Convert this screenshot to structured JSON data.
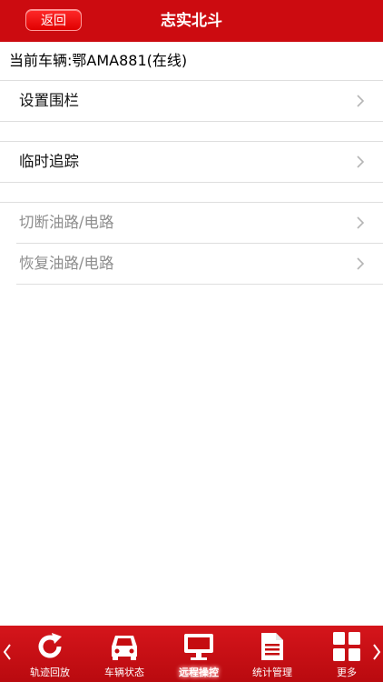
{
  "header": {
    "back_label": "返回",
    "title": "志实北斗"
  },
  "vehicle": {
    "current": "当前车辆:鄂AMA881(在线)"
  },
  "menu": {
    "geofence": "设置围栏",
    "temp_tracking": "临时追踪",
    "cut_fuel": "切断油路/电路",
    "restore_fuel": "恢复油路/电路"
  },
  "tabbar": {
    "tabs": [
      {
        "label": "轨迹回放",
        "icon": "refresh-icon"
      },
      {
        "label": "车辆状态",
        "icon": "car-icon"
      },
      {
        "label": "远程操控",
        "icon": "monitor-icon"
      },
      {
        "label": "统计管理",
        "icon": "document-icon"
      },
      {
        "label": "更多",
        "icon": "grid-icon"
      }
    ],
    "active_index": 2
  },
  "colors": {
    "brand_red": "#cc0b10",
    "disabled_text": "#8e8e8e"
  }
}
